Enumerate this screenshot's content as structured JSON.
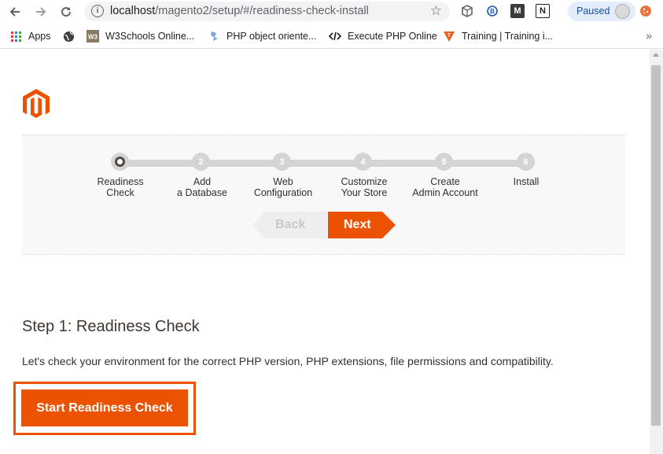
{
  "browser": {
    "url_host": "localhost",
    "url_path": "/magento2/setup/#/readiness-check-install",
    "profile_status": "Paused",
    "bookmarks": [
      {
        "label": "Apps",
        "icon": "apps-grid-icon"
      },
      {
        "label": "",
        "icon": "globe-icon"
      },
      {
        "label": "W3Schools Online...",
        "icon": "w3schools-icon"
      },
      {
        "label": "PHP object oriente...",
        "icon": "php-icon"
      },
      {
        "label": "Execute PHP Online",
        "icon": "code-icon"
      },
      {
        "label": "Training | Training i...",
        "icon": "training-icon"
      }
    ],
    "more_label": "»"
  },
  "wizard": {
    "steps": [
      {
        "number": "1",
        "label_line1": "Readiness",
        "label_line2": "Check",
        "active": true
      },
      {
        "number": "2",
        "label_line1": "Add",
        "label_line2": "a Database",
        "active": false
      },
      {
        "number": "3",
        "label_line1": "Web",
        "label_line2": "Configuration",
        "active": false
      },
      {
        "number": "4",
        "label_line1": "Customize",
        "label_line2": "Your Store",
        "active": false
      },
      {
        "number": "5",
        "label_line1": "Create",
        "label_line2": "Admin Account",
        "active": false
      },
      {
        "number": "6",
        "label_line1": "Install",
        "label_line2": "",
        "active": false
      }
    ],
    "back_label": "Back",
    "next_label": "Next"
  },
  "content": {
    "heading": "Step 1: Readiness Check",
    "description": "Let's check your environment for the correct PHP version, PHP extensions, file permissions and compatibility.",
    "start_button": "Start Readiness Check"
  },
  "colors": {
    "accent": "#eb5202",
    "rail": "#d4d4d4",
    "wizard_bg": "#f8f8f8"
  }
}
